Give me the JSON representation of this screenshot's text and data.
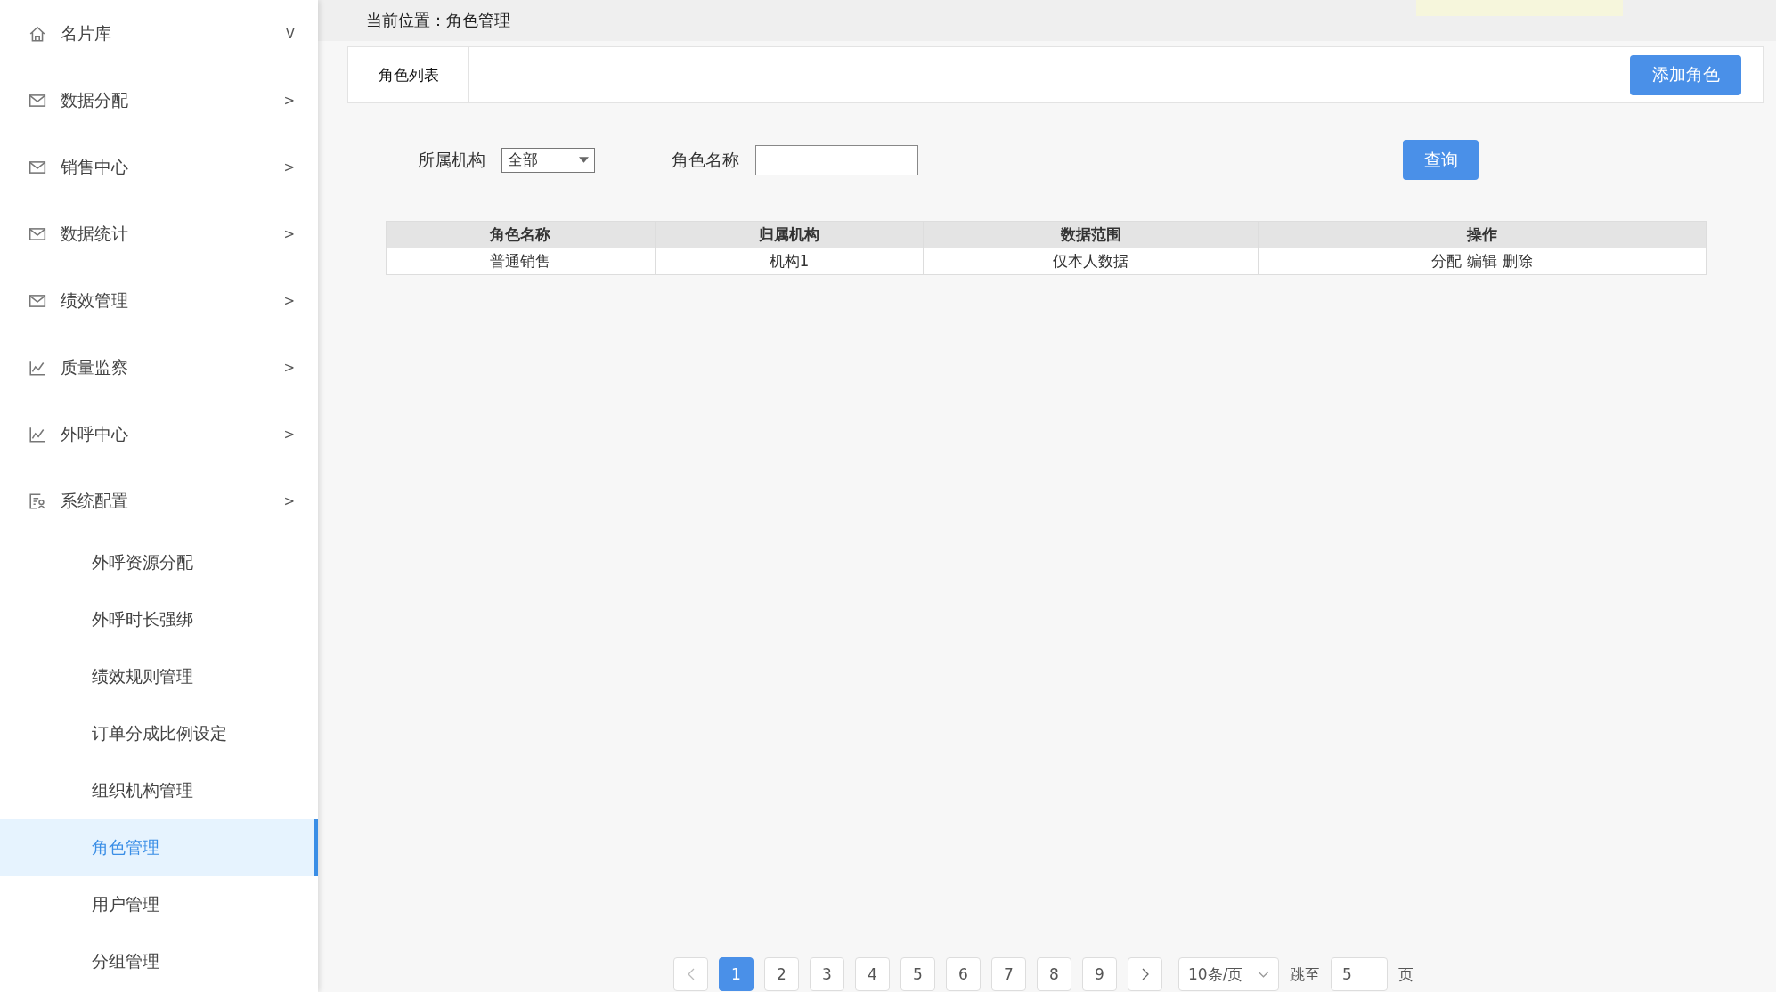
{
  "sidebar": {
    "items": [
      {
        "label": "名片库",
        "kind": "home",
        "arrow": "V",
        "selected": false
      },
      {
        "label": "数据分配",
        "kind": "mail",
        "arrow": ">",
        "selected": false
      },
      {
        "label": "销售中心",
        "kind": "mail",
        "arrow": ">",
        "selected": false
      },
      {
        "label": "数据统计",
        "kind": "mail",
        "arrow": ">",
        "selected": false
      },
      {
        "label": "绩效管理",
        "kind": "mail",
        "arrow": ">",
        "selected": false
      },
      {
        "label": "质量监察",
        "kind": "chart",
        "arrow": ">",
        "selected": false
      },
      {
        "label": "外呼中心",
        "kind": "chart",
        "arrow": ">",
        "selected": false
      },
      {
        "label": "系统配置",
        "kind": "form",
        "arrow": ">",
        "selected": false,
        "children": [
          {
            "label": "外呼资源分配",
            "selected": false
          },
          {
            "label": "外呼时长强绑",
            "selected": false
          },
          {
            "label": "绩效规则管理",
            "selected": false
          },
          {
            "label": "订单分成比例设定",
            "selected": false
          },
          {
            "label": "组织机构管理",
            "selected": false
          },
          {
            "label": "角色管理",
            "selected": true
          },
          {
            "label": "用户管理",
            "selected": false
          },
          {
            "label": "分组管理",
            "selected": false
          }
        ]
      }
    ]
  },
  "breadcrumb": {
    "label": "当前位置：",
    "current": "角色管理"
  },
  "tabs": [
    {
      "label": "角色列表",
      "selected": true
    }
  ],
  "add_button": "添加角色",
  "filters": {
    "org_label": "所属机构",
    "org_value": "全部",
    "name_label": "角色名称",
    "query_button": "查询"
  },
  "table": {
    "columns": [
      "角色名称",
      "归属机构",
      "数据范围",
      "操作"
    ],
    "rows": [
      {
        "cells": [
          "普通销售",
          "机构1",
          "仅本人数据"
        ],
        "actions": [
          "分配",
          "编辑",
          "删除"
        ]
      }
    ]
  },
  "pagination": {
    "pages": [
      {
        "label": "1",
        "selected": true
      },
      {
        "label": "2",
        "selected": false
      },
      {
        "label": "3",
        "selected": false
      },
      {
        "label": "4",
        "selected": false
      },
      {
        "label": "5",
        "selected": false
      },
      {
        "label": "6",
        "selected": false
      },
      {
        "label": "7",
        "selected": false
      },
      {
        "label": "8",
        "selected": false
      },
      {
        "label": "9",
        "selected": false
      }
    ],
    "page_size": "10条/页",
    "jump_label": "跳至",
    "jump_value": "5",
    "page_unit": "页"
  }
}
